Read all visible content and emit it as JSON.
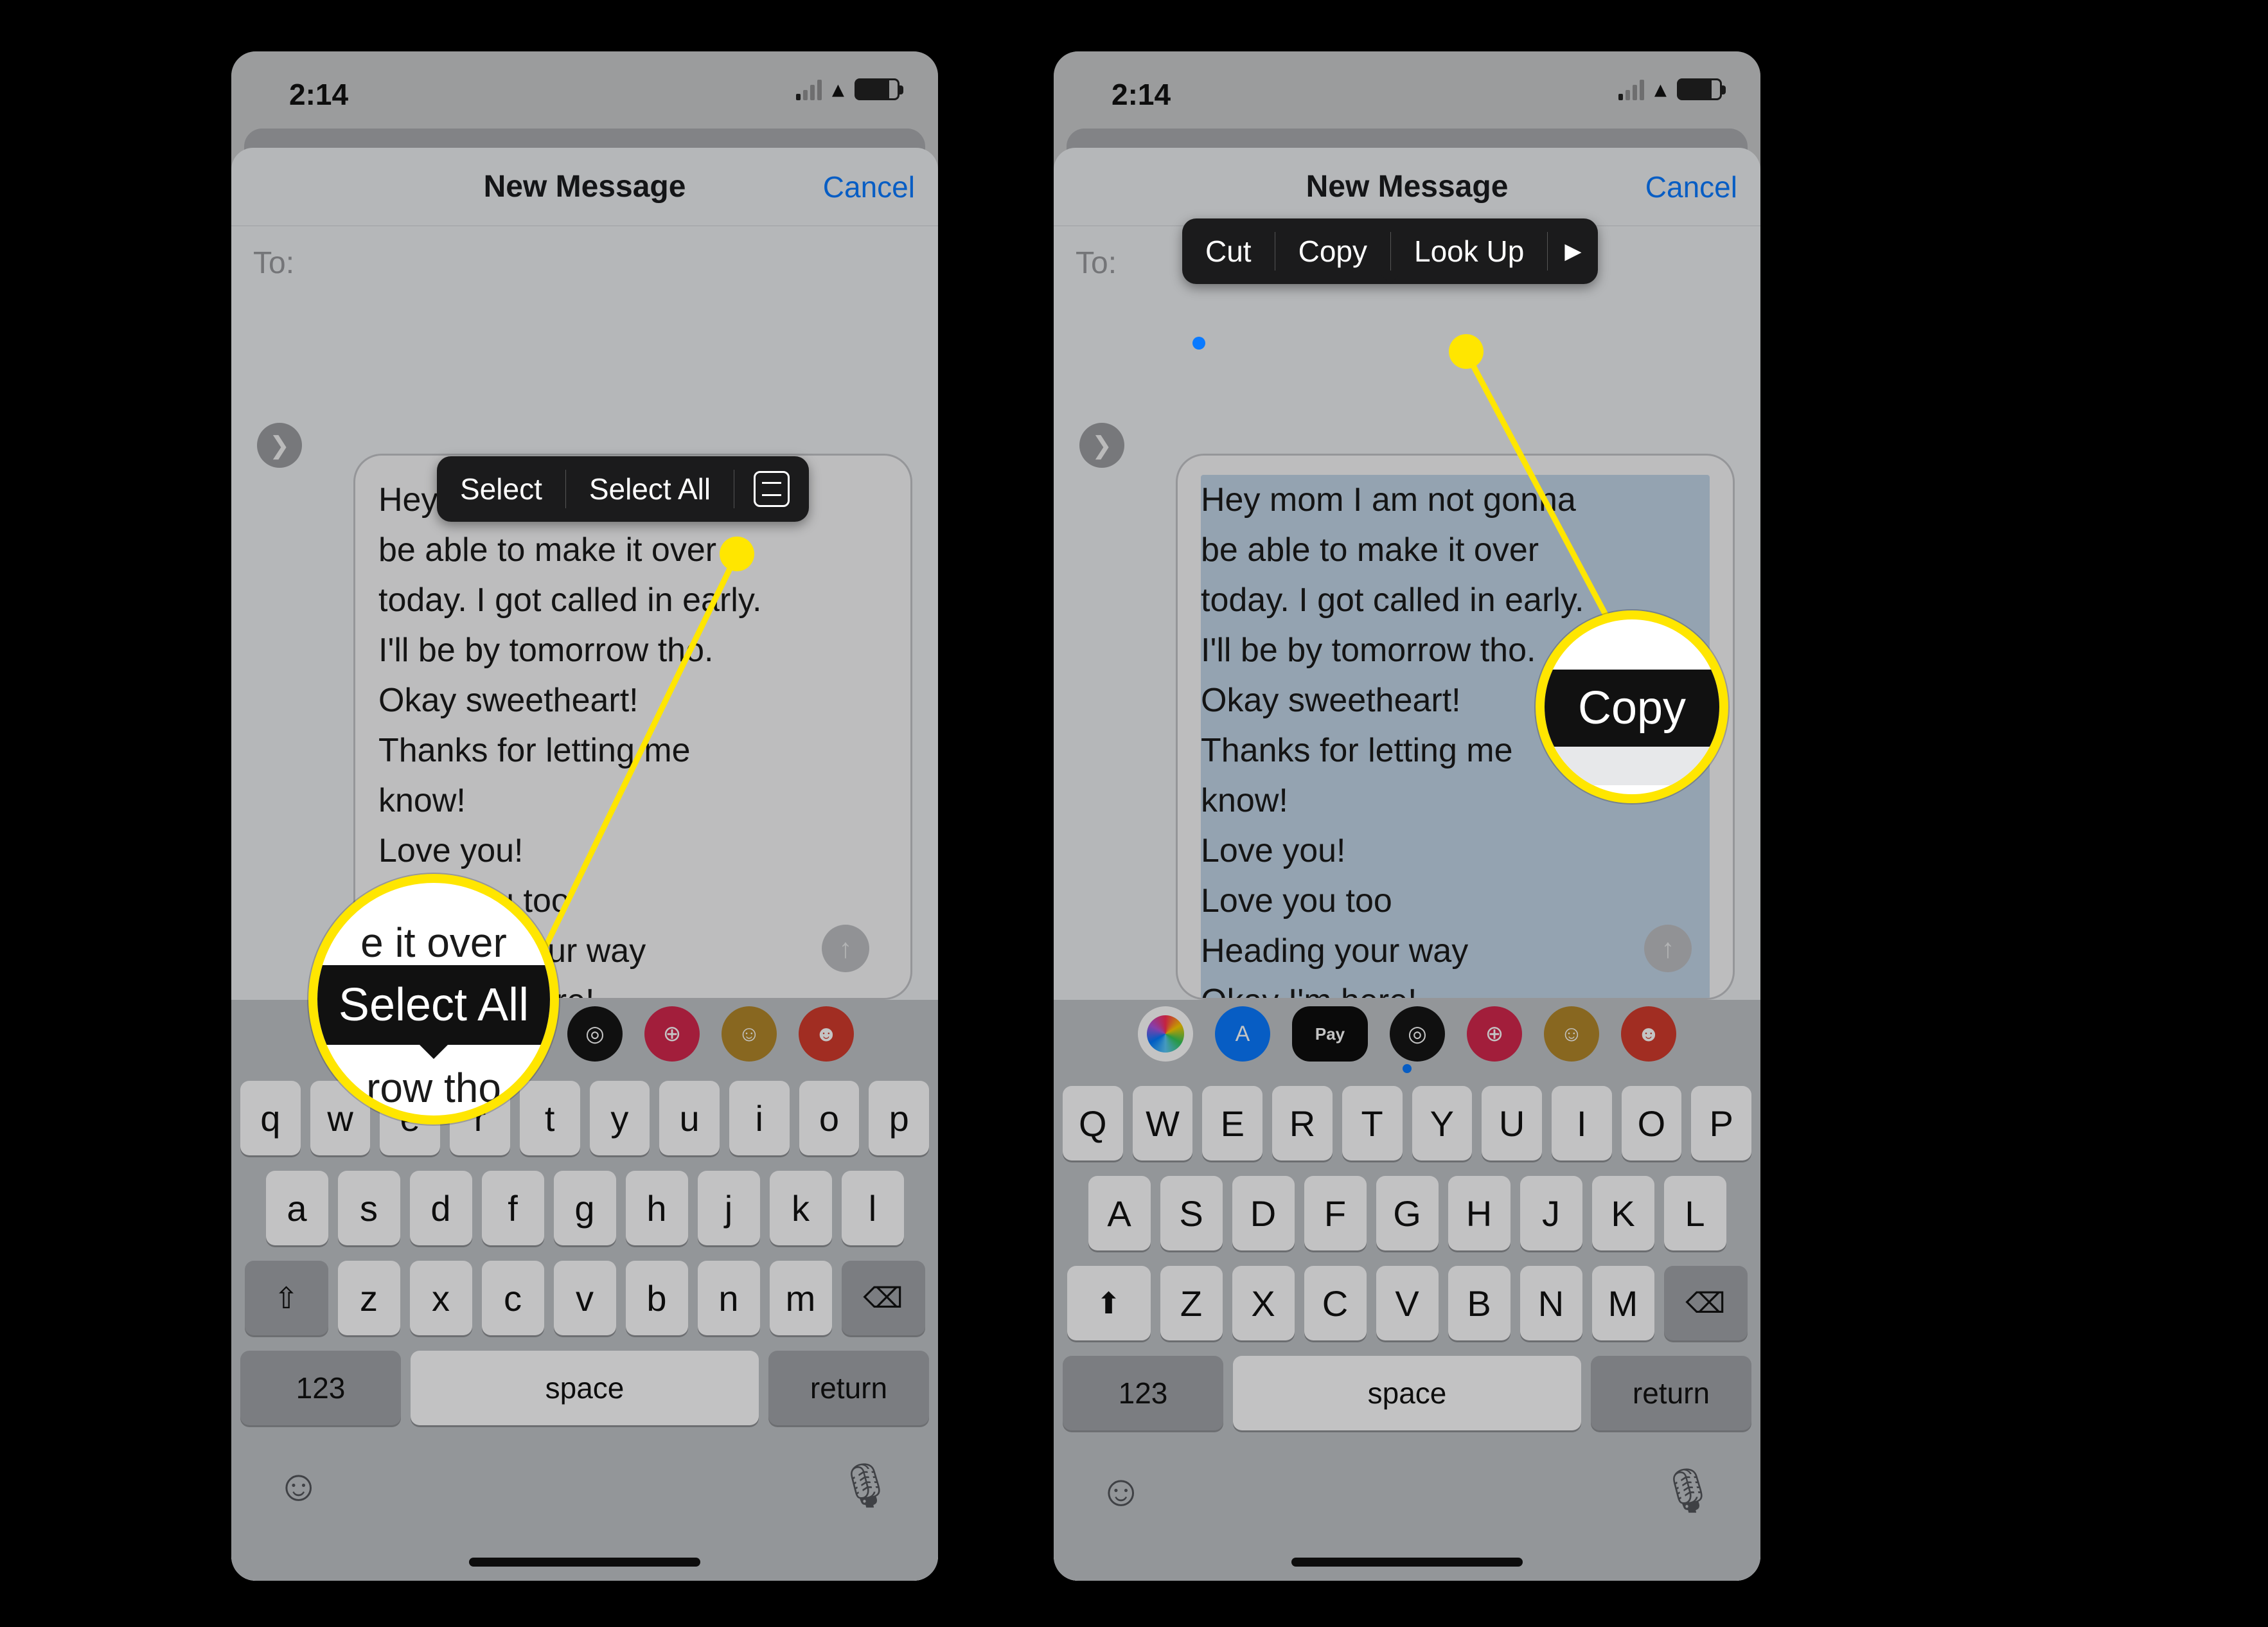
{
  "status": {
    "time": "2:14"
  },
  "header": {
    "title": "New Message",
    "cancel": "Cancel"
  },
  "to": {
    "label": "To:"
  },
  "message": {
    "lines": [
      "Hey mom I am not gonna",
      "be able to make it over",
      "today. I got called in early.",
      "I'll be by tomorrow tho.",
      "Okay sweetheart!",
      "Thanks for letting me",
      "know!",
      "Love you!",
      "Love you too",
      "Heading your way",
      "Okay  I'm here!"
    ]
  },
  "ctx1": {
    "select": "Select",
    "select_all": "Select All"
  },
  "ctx2": {
    "cut": "Cut",
    "copy": "Copy",
    "lookup": "Look Up"
  },
  "keyboard": {
    "row1": [
      "Q",
      "W",
      "E",
      "R",
      "T",
      "Y",
      "U",
      "I",
      "O",
      "P"
    ],
    "row2": [
      "A",
      "S",
      "D",
      "F",
      "G",
      "H",
      "J",
      "K",
      "L"
    ],
    "row3": [
      "Z",
      "X",
      "C",
      "V",
      "B",
      "N",
      "M"
    ],
    "k123": "123",
    "space": "space",
    "return": "return"
  },
  "apps": {
    "pay_label": "Pay"
  },
  "magnifier1": {
    "top_fragment": "e it over",
    "label": "Select All",
    "bottom_fragment": "row tho"
  },
  "magnifier2": {
    "label": "Copy"
  }
}
